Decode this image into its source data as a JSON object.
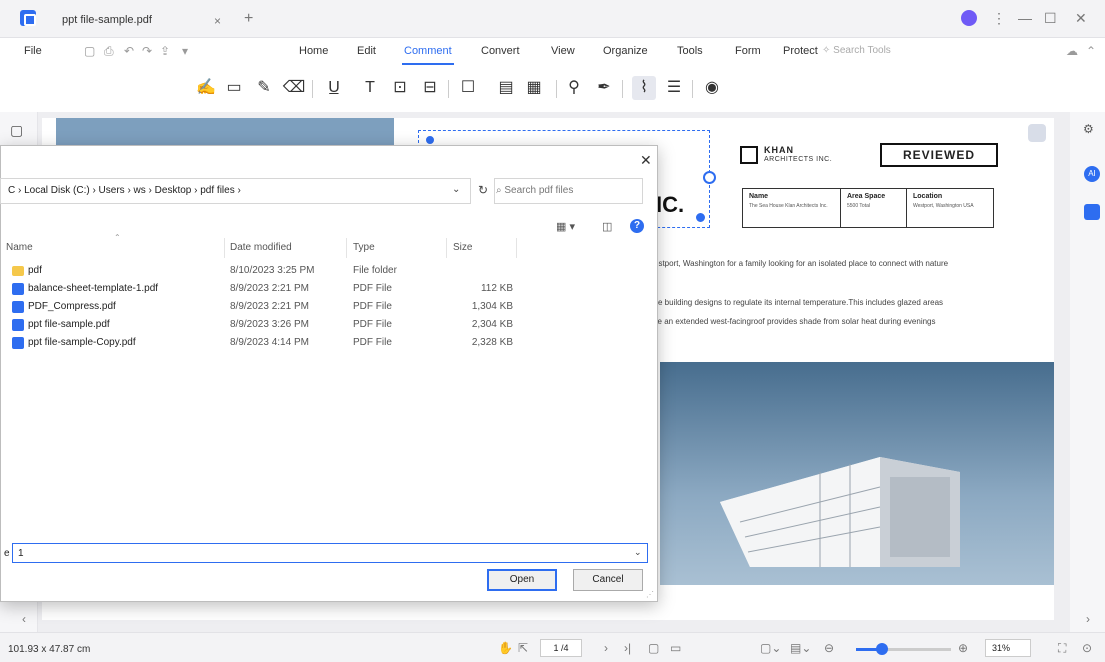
{
  "window": {
    "tab_title": "ppt file-sample.pdf",
    "tab_close": "×",
    "tab_add": "+",
    "controls": [
      "⋮",
      "—",
      "☐",
      "✕"
    ]
  },
  "menu": {
    "file": "File",
    "items": [
      "Home",
      "Edit",
      "Comment",
      "Convert",
      "View",
      "Organize",
      "Tools",
      "Form",
      "Protect"
    ],
    "active": "Comment",
    "search_tools": "Search Tools"
  },
  "document": {
    "big_text": "IC.",
    "company_name": "KHAN",
    "company_sub": "ARCHITECTS INC.",
    "stamp": "REVIEWED",
    "table": [
      {
        "head": "Name",
        "body": "The Sea House Klan Architects Inc."
      },
      {
        "head": "Area Space",
        "body": "5500 Total"
      },
      {
        "head": "Location",
        "body": "Westport, Washington USA"
      }
    ],
    "para1": "estport, Washington for a family looking for an isolated place to connect with nature",
    "para2a": "ve building designs to regulate its internal temperature.This includes glazed areas",
    "para2b": "ile an extended west-facingroof provides shade from solar heat during evenings"
  },
  "dialog": {
    "close": "✕",
    "path": "C  ›  Local Disk (C:)  ›  Users  ›  ws  ›  Desktop  ›  pdf files  ›",
    "search_placeholder": "Search pdf files",
    "columns": {
      "name": "Name",
      "date": "Date modified",
      "type": "Type",
      "size": "Size"
    },
    "files": [
      {
        "name": "pdf",
        "date": "8/10/2023 3:25 PM",
        "type": "File folder",
        "size": "",
        "kind": "folder"
      },
      {
        "name": "balance-sheet-template-1.pdf",
        "date": "8/9/2023 2:21 PM",
        "type": "PDF File",
        "size": "112 KB",
        "kind": "pdf"
      },
      {
        "name": "PDF_Compress.pdf",
        "date": "8/9/2023 2:21 PM",
        "type": "PDF File",
        "size": "1,304 KB",
        "kind": "pdf"
      },
      {
        "name": "ppt file-sample.pdf",
        "date": "8/9/2023 3:26 PM",
        "type": "PDF File",
        "size": "2,304 KB",
        "kind": "pdf"
      },
      {
        "name": "ppt file-sample-Copy.pdf",
        "date": "8/9/2023 4:14 PM",
        "type": "PDF File",
        "size": "2,328 KB",
        "kind": "pdf"
      }
    ],
    "filename_label": "e",
    "filename_value": "1",
    "open_button": "Open",
    "cancel_button": "Cancel"
  },
  "status": {
    "dimensions": "101.93 x 47.87 cm",
    "page": "1 /4",
    "zoom": "31%"
  }
}
